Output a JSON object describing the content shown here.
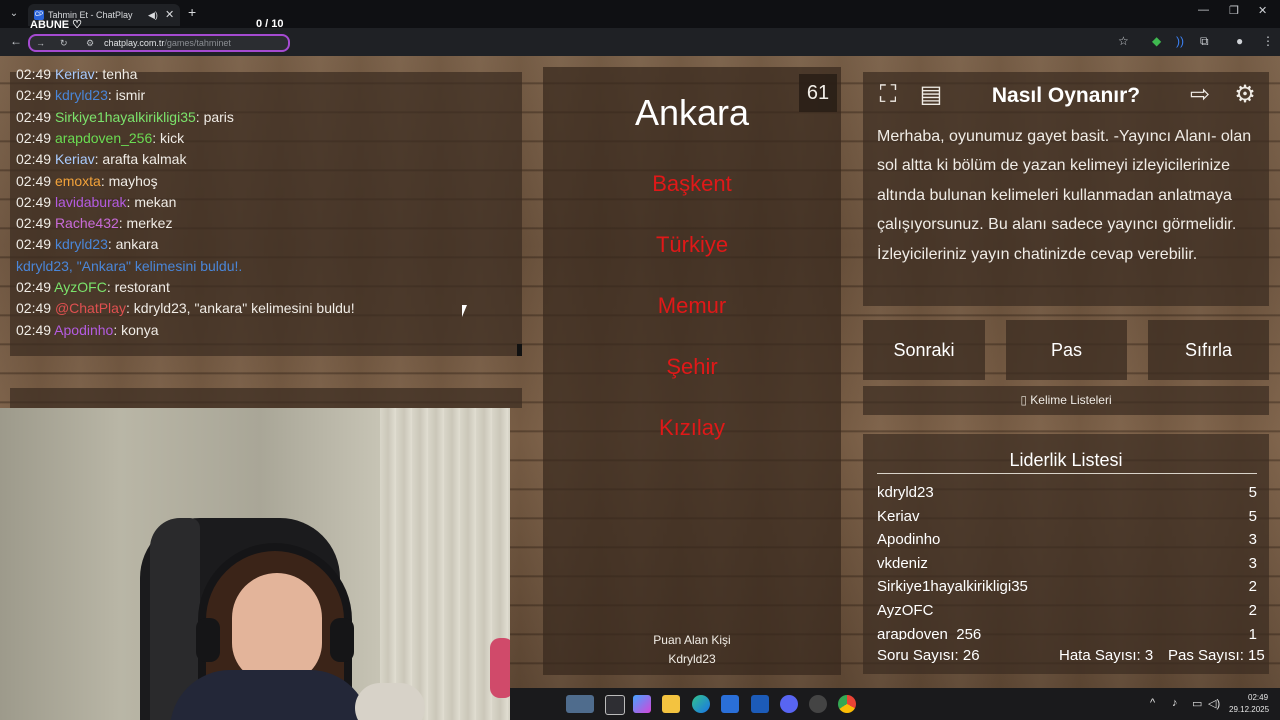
{
  "browser": {
    "tab_title": "Tahmin Et - ChatPlay",
    "tab_favicon": "CP",
    "url_host": "chatplay.com.tr",
    "url_path": "/games/tahminet"
  },
  "stream_overlay": {
    "abune": "ABUNE ♡",
    "counter": "0  / 10"
  },
  "chat": [
    {
      "time": "02:49",
      "user": "Keriav",
      "user_color": "#aaccff",
      "msg": "tenha"
    },
    {
      "time": "02:49",
      "user": "kdryld23",
      "user_color": "#4a86d8",
      "msg": "ismir"
    },
    {
      "time": "02:49",
      "user": "Sirkiye1hayalkirikligi35",
      "user_color": "#7be36b",
      "msg": "paris"
    },
    {
      "time": "02:49",
      "user": "arapdoven_256",
      "user_color": "#6bdc52",
      "msg": "kick"
    },
    {
      "time": "02:49",
      "user": "Keriav",
      "user_color": "#aaccff",
      "msg": "arafta kalmak"
    },
    {
      "time": "02:49",
      "user": "emoxta",
      "user_color": "#f2a23a",
      "msg": "mayhoş"
    },
    {
      "time": "02:49",
      "user": "lavidaburak",
      "user_color": "#b45ce0",
      "msg": "mekan"
    },
    {
      "time": "02:49",
      "user": "Rache432",
      "user_color": "#c86bd8",
      "msg": "merkez"
    },
    {
      "time": "02:49",
      "user": "kdryld23",
      "user_color": "#4a86d8",
      "msg": "ankara"
    },
    {
      "time": "",
      "user": "",
      "user_color": "#4a86d8",
      "msg": "kdryld23, \"Ankara\" kelimesini buldu!."
    },
    {
      "time": "02:49",
      "user": "AyzOFC",
      "user_color": "#7be36b",
      "msg": "restorant"
    },
    {
      "time": "02:49",
      "user": "@ChatPlay",
      "user_color": "#e05050",
      "msg": "kdryld23, \"ankara\" kelimesini buldu!"
    },
    {
      "time": "02:49",
      "user": "Apodinho",
      "user_color": "#b45ce0",
      "msg": "konya"
    }
  ],
  "game": {
    "timer": "61",
    "word": "Ankara",
    "taboo_words": [
      "Başkent",
      "Türkiye",
      "Memur",
      "Şehir",
      "Kızılay"
    ],
    "scorer_label": "Puan Alan Kişi",
    "scorer_name": "Kdryld23"
  },
  "help": {
    "title": "Nasıl Oynanır?",
    "text": "Merhaba, oyunumuz gayet basit. -Yayıncı Alanı- olan sol altta ki bölüm de yazan kelimeyi izleyicilerinize altında bulunan kelimeleri kullanmadan anlatmaya çalışıyorsunuz. Bu alanı sadece yayıncı görmelidir. İzleyicileriniz yayın chatinizde cevap verebilir."
  },
  "buttons": {
    "next": "Sonraki",
    "pass": "Pas",
    "reset": "Sıfırla",
    "word_lists": "Kelime Listeleri"
  },
  "leaderboard": {
    "title": "Liderlik Listesi",
    "rows": [
      {
        "name": "kdryld23",
        "score": "5"
      },
      {
        "name": "Keriav",
        "score": "5"
      },
      {
        "name": "Apodinho",
        "score": "3"
      },
      {
        "name": "vkdeniz",
        "score": "3"
      },
      {
        "name": "Sirkiye1hayalkirikligi35",
        "score": "2"
      },
      {
        "name": "AyzOFC",
        "score": "2"
      },
      {
        "name": "arapdoven_256",
        "score": "1"
      }
    ]
  },
  "stats": {
    "questions": "Soru Sayısı: 26",
    "errors": "Hata Sayısı: 3",
    "passes": "Pas Sayısı: 15"
  },
  "taskbar": {
    "time": "02:49",
    "date": "29.12.2025"
  },
  "colors": {
    "taboo": "#e01818",
    "accent_omnibox": "#a54bd1"
  }
}
